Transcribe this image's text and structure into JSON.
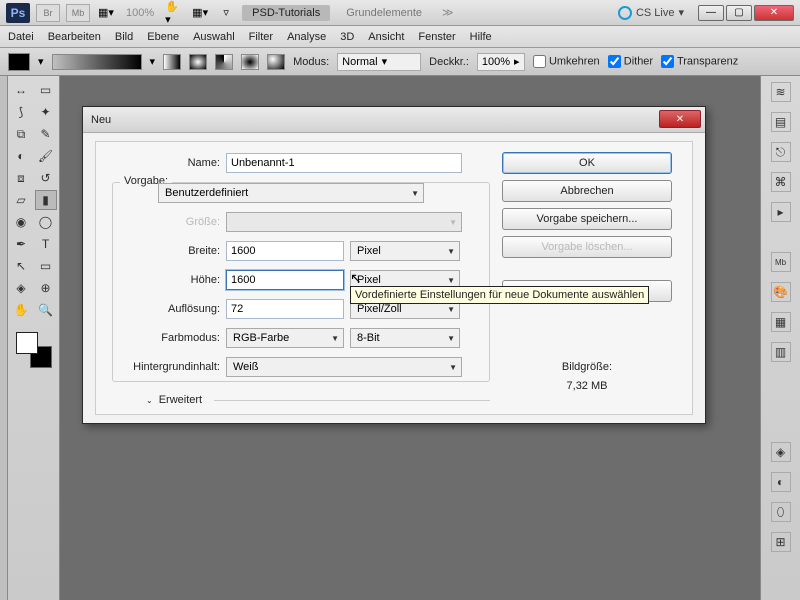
{
  "topbar": {
    "br": "Br",
    "mb": "Mb",
    "zoom": "100%",
    "tab_active": "PSD-Tutorials",
    "tab_inactive": "Grundelemente",
    "cslive": "CS Live"
  },
  "menu": [
    "Datei",
    "Bearbeiten",
    "Bild",
    "Ebene",
    "Auswahl",
    "Filter",
    "Analyse",
    "3D",
    "Ansicht",
    "Fenster",
    "Hilfe"
  ],
  "optbar": {
    "mode_label": "Modus:",
    "mode_value": "Normal",
    "opacity_label": "Deckkr.:",
    "opacity_value": "100%",
    "reverse": "Umkehren",
    "dither": "Dither",
    "transparency": "Transparenz"
  },
  "dialog": {
    "title": "Neu",
    "name_label": "Name:",
    "name_value": "Unbenannt-1",
    "preset_label": "Vorgabe:",
    "preset_value": "Benutzerdefiniert",
    "size_label": "Größe:",
    "size_value": "",
    "width_label": "Breite:",
    "width_value": "1600",
    "width_unit": "Pixel",
    "height_label": "Höhe:",
    "height_value": "1600",
    "height_unit": "Pixel",
    "res_label": "Auflösung:",
    "res_value": "72",
    "res_unit": "Pixel/Zoll",
    "colormode_label": "Farbmodus:",
    "colormode_value": "RGB-Farbe",
    "colordepth": "8-Bit",
    "bg_label": "Hintergrundinhalt:",
    "bg_value": "Weiß",
    "advanced": "Erweitert",
    "ok": "OK",
    "cancel": "Abbrechen",
    "save_preset": "Vorgabe speichern...",
    "delete_preset": "Vorgabe löschen...",
    "device_central": "Device Central...",
    "filesize_label": "Bildgröße:",
    "filesize": "7,32 MB"
  },
  "tooltip": "Vordefinierte Einstellungen für neue Dokumente auswählen"
}
